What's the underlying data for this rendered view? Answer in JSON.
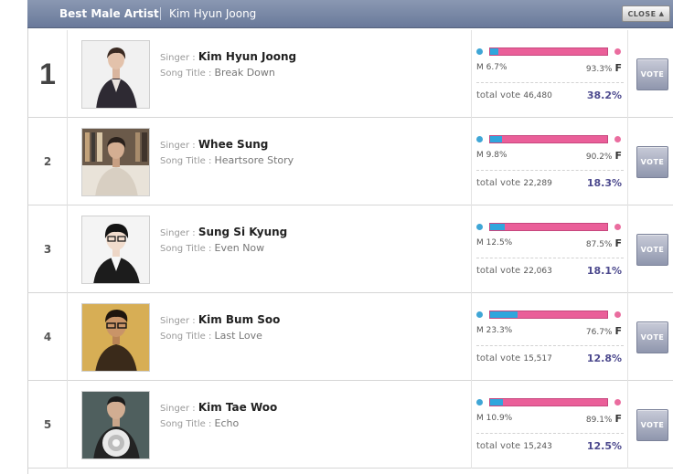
{
  "header": {
    "category": "Best Male Artist",
    "winner": "Kim Hyun Joong",
    "close_label": "CLOSE",
    "close_arrow": "▲"
  },
  "labels": {
    "singer": "Singer : ",
    "song": "Song Title : ",
    "total": "total vote ",
    "m": "M ",
    "f": "F",
    "vote": "VOTE"
  },
  "colors": {
    "male": "#2fa6dd",
    "female": "#ea5f99",
    "share": "#4d4a8e",
    "header": "#7a89a6"
  },
  "rows": [
    {
      "rank": "1",
      "singer": "Kim Hyun Joong",
      "song": "Break Down",
      "male_pct": "6.7%",
      "female_pct": "93.3%",
      "male_fraction": 0.067,
      "total_vote": "46,480",
      "share": "38.2%"
    },
    {
      "rank": "2",
      "singer": "Whee Sung",
      "song": "Heartsore Story",
      "male_pct": "9.8%",
      "female_pct": "90.2%",
      "male_fraction": 0.098,
      "total_vote": "22,289",
      "share": "18.3%"
    },
    {
      "rank": "3",
      "singer": "Sung Si Kyung",
      "song": "Even Now",
      "male_pct": "12.5%",
      "female_pct": "87.5%",
      "male_fraction": 0.125,
      "total_vote": "22,063",
      "share": "18.1%"
    },
    {
      "rank": "4",
      "singer": "Kim Bum Soo",
      "song": "Last Love",
      "male_pct": "23.3%",
      "female_pct": "76.7%",
      "male_fraction": 0.233,
      "total_vote": "15,517",
      "share": "12.8%"
    },
    {
      "rank": "5",
      "singer": "Kim Tae Woo",
      "song": "Echo",
      "male_pct": "10.9%",
      "female_pct": "89.1%",
      "male_fraction": 0.109,
      "total_vote": "15,243",
      "share": "12.5%"
    }
  ]
}
